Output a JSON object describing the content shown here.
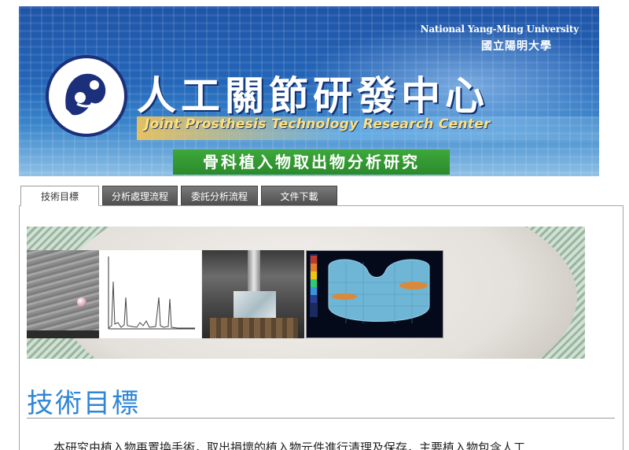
{
  "banner": {
    "university_en": "National Yang-Ming University",
    "university_zh": "國立陽明大學",
    "title_zh": "人工關節研發中心",
    "title_en": "Joint Prosthesis Technology Research Center",
    "research_title": "骨科植入物取出物分析研究",
    "colors": {
      "banner_blue": "#2466b8",
      "subtitle_yellow": "#ffe07a",
      "green_band": "#3da83b"
    }
  },
  "tabs": [
    {
      "label": "技術目標",
      "active": true
    },
    {
      "label": "分析處理流程",
      "active": false
    },
    {
      "label": "委託分析流程",
      "active": false
    },
    {
      "label": "文件下載",
      "active": false
    }
  ],
  "hero": {
    "images": [
      "sem-micrograph",
      "eds-spectrum",
      "mechanical-test",
      "fem-contact-map"
    ]
  },
  "content": {
    "heading": "技術目標",
    "heading_color": "#2f86d6",
    "paragraph": "本研究由植入物再置換手術，取出損壞的植入物元件進行清理及保存，主要植入物包含人工"
  }
}
